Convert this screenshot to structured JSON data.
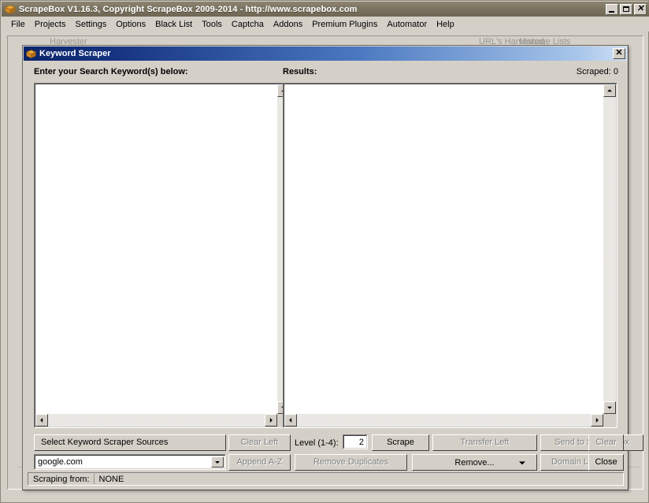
{
  "app": {
    "title": "ScrapeBox V1.16.3, Copyright ScrapeBox 2009-2014 - http://www.scrapebox.com",
    "icon": "box-icon",
    "window_controls": {
      "minimize": "minimize-icon",
      "maximize": "maximize-icon",
      "close": "close-icon"
    },
    "menu": [
      {
        "label": "File"
      },
      {
        "label": "Projects"
      },
      {
        "label": "Settings"
      },
      {
        "label": "Options"
      },
      {
        "label": "Black List"
      },
      {
        "label": "Tools"
      },
      {
        "label": "Captcha"
      },
      {
        "label": "Addons"
      },
      {
        "label": "Premium Plugins"
      },
      {
        "label": "Automator"
      },
      {
        "label": "Help"
      }
    ]
  },
  "dialog": {
    "title": "Keyword Scraper",
    "icon": "box-icon",
    "close_label": "✕",
    "left_panel": {
      "label": "Enter your Search Keyword(s) below:",
      "value": ""
    },
    "right_panel": {
      "label": "Results:",
      "value": ""
    },
    "scraped_status": "Scraped: 0",
    "controls": {
      "select_sources": {
        "label": "Select Keyword Scraper Sources",
        "disabled": false
      },
      "source_combo": {
        "value": "google.com",
        "disabled": false
      },
      "clear_left": {
        "label": "Clear Left",
        "disabled": true
      },
      "append_az": {
        "label": "Append A-Z",
        "disabled": true
      },
      "level_label": "Level (1-4):",
      "level_value": "2",
      "scrape": {
        "label": "Scrape",
        "disabled": false
      },
      "remove_duplicates": {
        "label": "Remove Duplicates",
        "disabled": true
      },
      "transfer_left": {
        "label": "Transfer Left",
        "disabled": true
      },
      "remove_combo": {
        "label": "Remove...",
        "disabled": false
      },
      "send_to_scrapebox": {
        "label": "Send to ScrapeBox",
        "disabled": true
      },
      "domain_lookup": {
        "label": "Domain Lookup",
        "disabled": true
      },
      "clear": {
        "label": "Clear",
        "disabled": true
      },
      "close": {
        "label": "Close",
        "disabled": false
      }
    },
    "statusbar": {
      "label": "Scraping from:",
      "value": "NONE"
    }
  },
  "background": {
    "ghost_left": "Harvester",
    "ghost_mid": "URL's Harvested",
    "ghost_right": "Manage Lists"
  },
  "colors": {
    "app_titlebar": "#7c7360",
    "dialog_titlebar_start": "#0a246a",
    "dialog_titlebar_end": "#cfe0f4",
    "face": "#d4d0c8",
    "field": "#ffffff",
    "disabled_text": "#808080"
  }
}
